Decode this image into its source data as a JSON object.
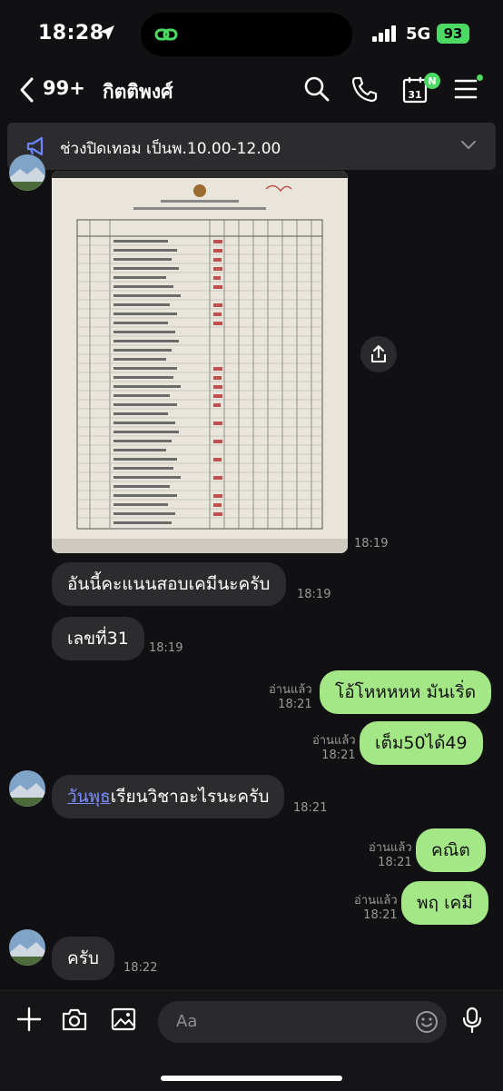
{
  "status_bar": {
    "time": "18:28",
    "network": "5G",
    "battery": "93"
  },
  "header": {
    "back_count": "99+",
    "title": "กิตติพงศ์",
    "calendar_day": "31",
    "calendar_badge": "N"
  },
  "announcement": {
    "text": "ช่วงปิดเทอม เป็นพ.10.00-12.00"
  },
  "messages": [
    {
      "type": "image",
      "direction": "in",
      "time": "18:19"
    },
    {
      "type": "text",
      "direction": "in",
      "text": "อันนี้คะแนนสอบเคมีนะครับ",
      "time": "18:19"
    },
    {
      "type": "text",
      "direction": "in",
      "text": "เลขที่31",
      "time": "18:19"
    },
    {
      "type": "text",
      "direction": "out",
      "text": "โอ้โหหหหห มันเริ่ด",
      "read": "อ่านแล้ว",
      "time": "18:21"
    },
    {
      "type": "text",
      "direction": "out",
      "text": "เต็ม50ได้49",
      "read": "อ่านแล้ว",
      "time": "18:21"
    },
    {
      "type": "text",
      "direction": "in",
      "link": "วันพุธ",
      "text": "เรียนวิชาอะไรนะครับ",
      "time": "18:21"
    },
    {
      "type": "text",
      "direction": "out",
      "text": "คณิต",
      "read": "อ่านแล้ว",
      "time": "18:21"
    },
    {
      "type": "text",
      "direction": "out",
      "text": "พฤ เคมี",
      "read": "อ่านแล้ว",
      "time": "18:21"
    },
    {
      "type": "text",
      "direction": "in",
      "text": "ครับ",
      "time": "18:22"
    }
  ],
  "composer": {
    "placeholder": "Aa"
  },
  "colors": {
    "outgoing_bubble": "#a4e786",
    "incoming_bubble": "#2c2c2e",
    "accent": "#4cd964",
    "link": "#7a8cff"
  },
  "icons": [
    "location-arrow-icon",
    "link-icon",
    "signal-icon",
    "back-chevron-icon",
    "search-icon",
    "phone-icon",
    "calendar-icon",
    "menu-icon",
    "megaphone-icon",
    "chevron-down-icon",
    "share-icon",
    "plus-icon",
    "camera-icon",
    "image-icon",
    "emoji-icon",
    "microphone-icon"
  ]
}
